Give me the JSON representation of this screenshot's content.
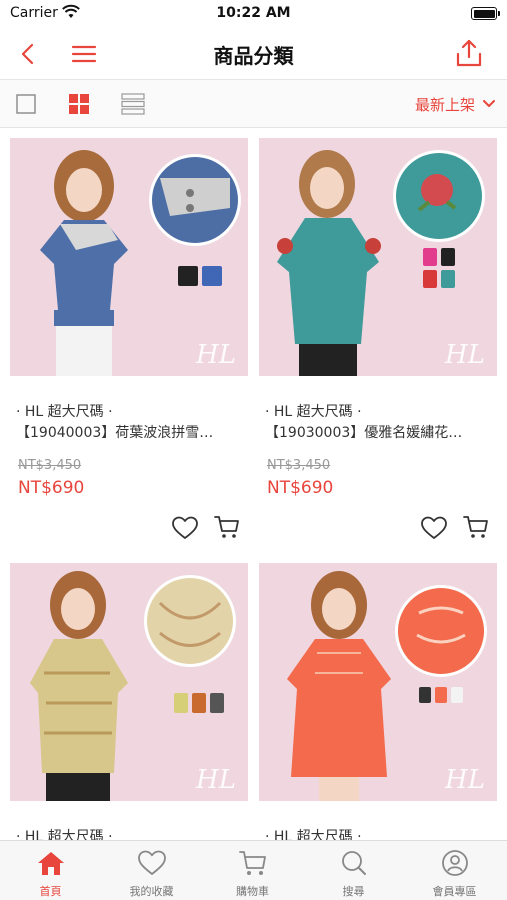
{
  "status_bar": {
    "carrier": "Carrier",
    "time": "10:22 AM"
  },
  "nav": {
    "title": "商品分類"
  },
  "toolbar": {
    "sort_label": "最新上架"
  },
  "colors": {
    "accent": "#e8453c",
    "image_bg": "#efd6df"
  },
  "products": [
    {
      "line1": "· HL 超大尺碼 ·",
      "line2": "【19040003】荷葉波浪拼雪…",
      "price_old": "NT$3,450",
      "price_new": "NT$690",
      "brand_mark": "HL"
    },
    {
      "line1": "· HL 超大尺碼 ·",
      "line2": "【19030003】優雅名媛繡花…",
      "price_old": "NT$3,450",
      "price_new": "NT$690",
      "brand_mark": "HL"
    },
    {
      "line1": "· HL 超大尺碼 ·",
      "brand_mark": "HL"
    },
    {
      "line1": "· HL 超大尺碼 ·",
      "brand_mark": "HL"
    }
  ],
  "tabs": [
    {
      "label": "首頁",
      "icon": "home-icon",
      "active": true
    },
    {
      "label": "我的收藏",
      "icon": "heart-icon",
      "active": false
    },
    {
      "label": "購物車",
      "icon": "cart-icon",
      "active": false
    },
    {
      "label": "搜尋",
      "icon": "search-icon",
      "active": false
    },
    {
      "label": "會員專區",
      "icon": "user-icon",
      "active": false
    }
  ]
}
